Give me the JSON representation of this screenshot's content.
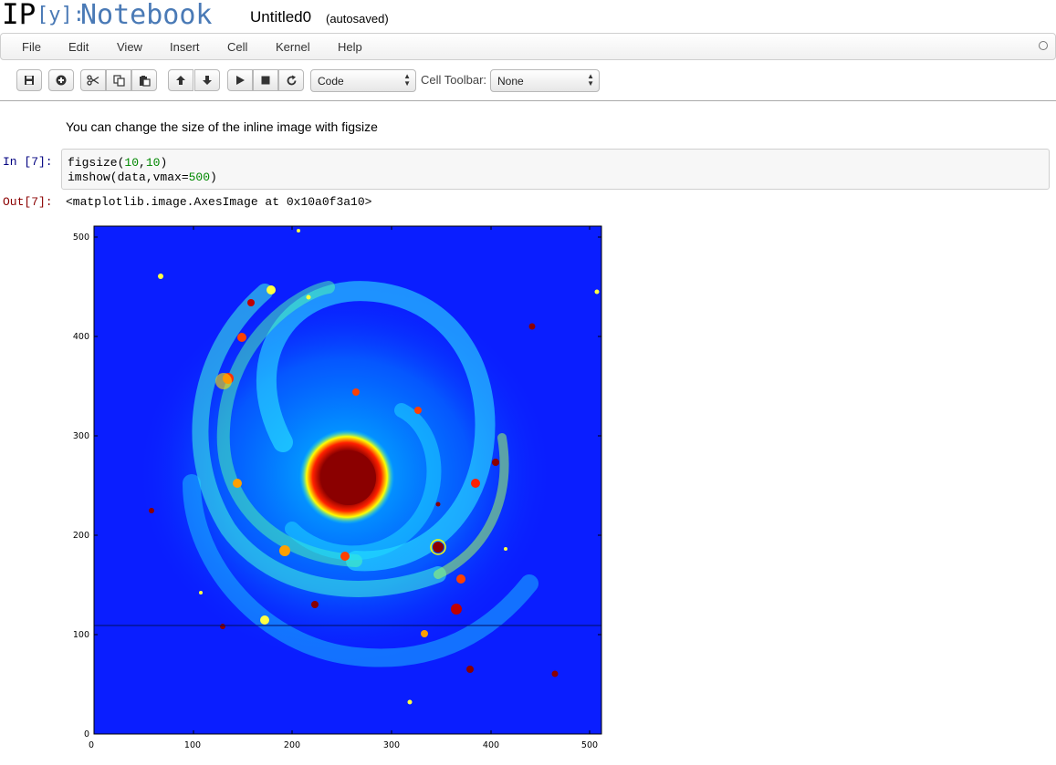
{
  "header": {
    "logo_ip": "IP",
    "logo_y": "[y]:",
    "logo_notebook": "Notebook",
    "notebook_name": "Untitled0",
    "save_status": "(autosaved)"
  },
  "menubar": {
    "items": [
      "File",
      "Edit",
      "View",
      "Insert",
      "Cell",
      "Kernel",
      "Help"
    ]
  },
  "toolbar": {
    "buttons": [
      "save-icon",
      "add-cell-icon",
      "cut-icon",
      "copy-icon",
      "paste-icon",
      "move-up-icon",
      "move-down-icon",
      "run-icon",
      "stop-icon",
      "restart-icon"
    ],
    "cell_type": "Code",
    "cell_toolbar_label": "Cell Toolbar:",
    "cell_toolbar_value": "None"
  },
  "cells": {
    "markdown_text": "You can change the size of the inline image with figsize",
    "in_prompt": "In [7]:",
    "out_prompt": "Out[7]:",
    "code_line1_fn": "figsize(",
    "code_line1_a": "10",
    "code_line1_sep": ",",
    "code_line1_b": "10",
    "code_line1_end": ")",
    "code_line2_a": "imshow(data,vmax=",
    "code_line2_num": "500",
    "code_line2_end": ")",
    "output_text": "<matplotlib.image.AxesImage at 0x10a0f3a10>"
  },
  "chart_data": {
    "type": "heatmap",
    "x_ticks": [
      "0",
      "100",
      "200",
      "300",
      "400",
      "500"
    ],
    "y_ticks": [
      "0",
      "100",
      "200",
      "300",
      "400",
      "500"
    ],
    "xlim": [
      0,
      512
    ],
    "ylim": [
      0,
      512
    ],
    "vmax": 500,
    "colormap": "jet",
    "background_color": "#0a1eff",
    "core_color": "#8b0000"
  }
}
